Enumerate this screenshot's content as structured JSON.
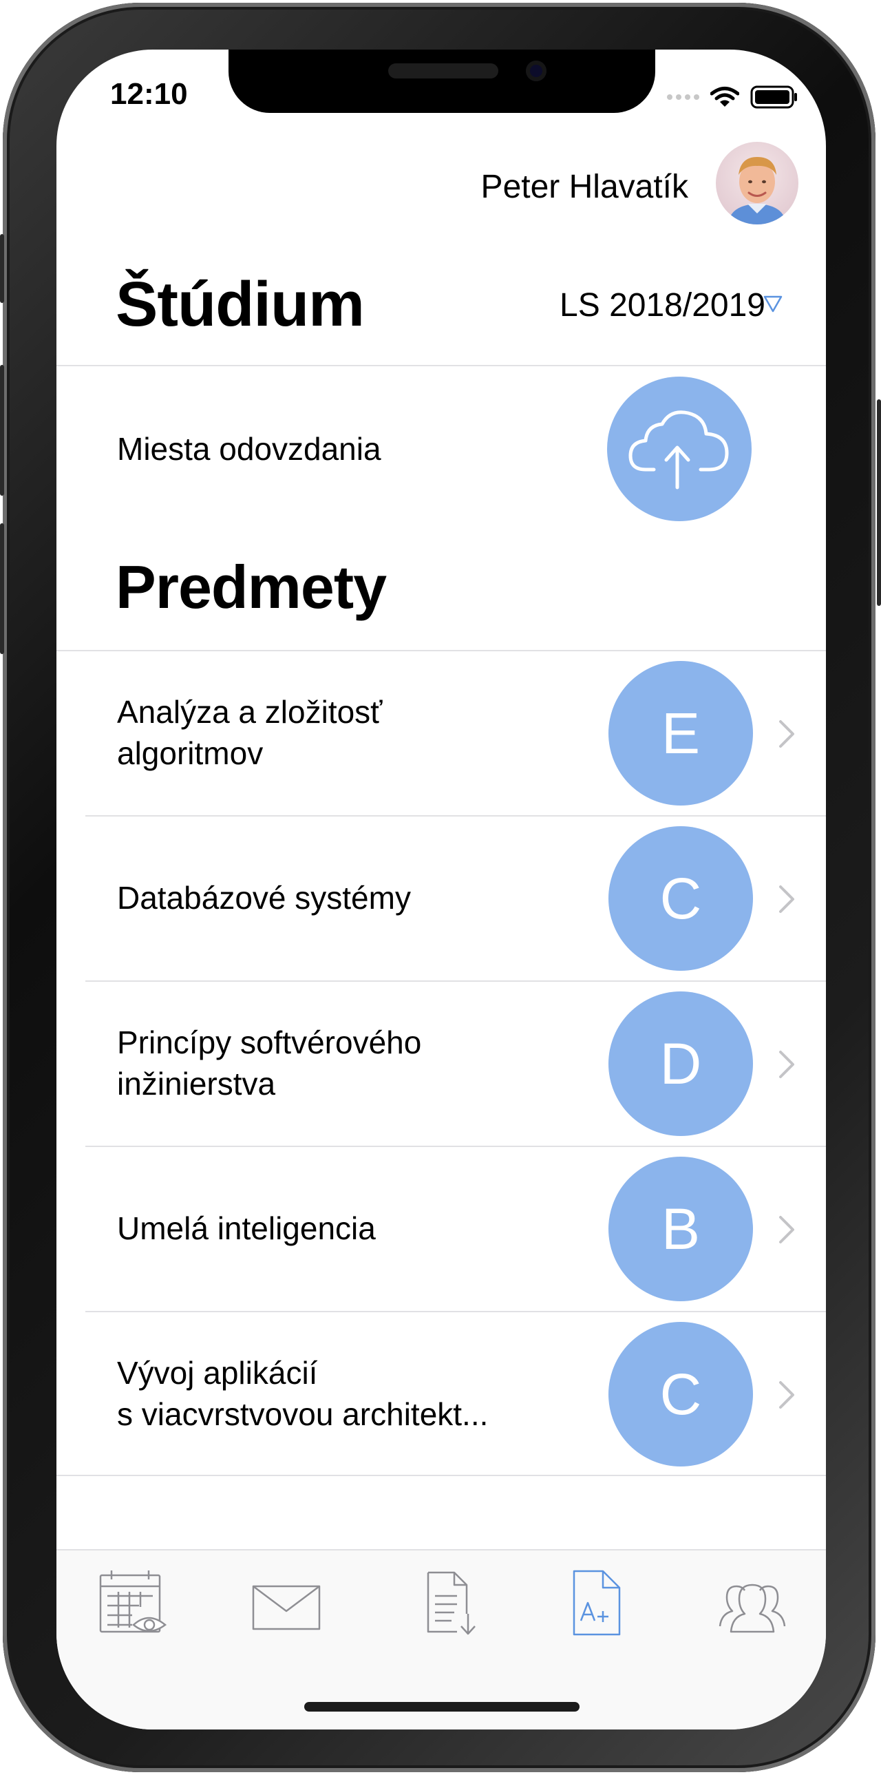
{
  "status": {
    "time": "12:10"
  },
  "header": {
    "user_name": "Peter Hlavatík",
    "title": "Štúdium",
    "semester": "LS 2018/2019"
  },
  "upload": {
    "label": "Miesta odovzdania"
  },
  "subjects": {
    "title": "Predmety",
    "items": [
      {
        "line1": "Analýza a zložitosť",
        "line2": "algoritmov",
        "grade": "E"
      },
      {
        "line1": "Databázové systémy",
        "line2": "",
        "grade": "C"
      },
      {
        "line1": "Princípy softvérového",
        "line2": "inžinierstva",
        "grade": "D"
      },
      {
        "line1": "Umelá inteligencia",
        "line2": "",
        "grade": "B"
      },
      {
        "line1": "Vývoj aplikácií",
        "line2": "s viacvrstvovou architekt...",
        "grade": "C"
      }
    ]
  },
  "tab_bar": {
    "tabs": [
      {
        "icon": "calendar-eye-icon",
        "active": false
      },
      {
        "icon": "mail-icon",
        "active": false
      },
      {
        "icon": "document-download-icon",
        "active": false
      },
      {
        "icon": "grade-document-icon",
        "active": true
      },
      {
        "icon": "people-icon",
        "active": false
      }
    ]
  },
  "colors": {
    "accent": "#8bb4ec",
    "active_tab": "#5b93e0",
    "inactive_tab": "#8e8e93"
  }
}
